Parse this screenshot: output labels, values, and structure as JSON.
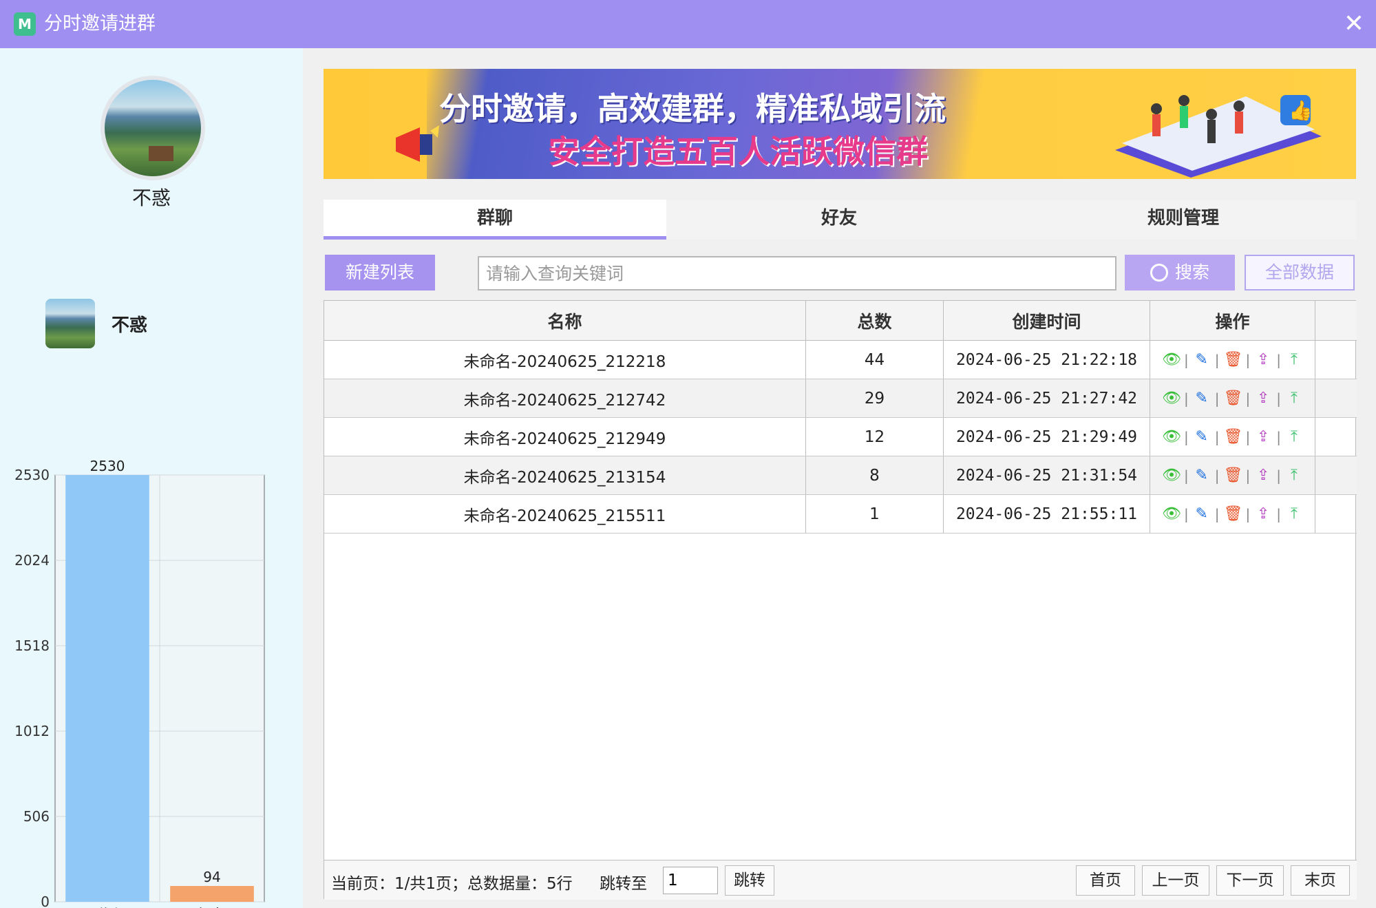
{
  "window": {
    "title": "分时邀请进群",
    "logo_text": "M",
    "close_symbol": "✕"
  },
  "sidebar": {
    "user_name_big": "不惑",
    "user_name_small": "不惑"
  },
  "chart_data": {
    "type": "bar",
    "categories": [
      "群聊",
      "好友"
    ],
    "values": [
      2530,
      94
    ],
    "yticks": [
      0,
      506,
      1012,
      1518,
      2024,
      2530
    ],
    "ylim": [
      0,
      2530
    ],
    "colors": [
      "#90c8f8",
      "#f4a46a"
    ],
    "grid": true,
    "legend": "none"
  },
  "banner": {
    "line1": "分时邀请，高效建群，精准私域引流",
    "line2": "安全打造五百人活跃微信群"
  },
  "tabs": [
    {
      "label": "群聊",
      "active": true
    },
    {
      "label": "好友",
      "active": false
    },
    {
      "label": "规则管理",
      "active": false
    }
  ],
  "toolbar": {
    "new_list_label": "新建列表",
    "search_placeholder": "请输入查询关键词",
    "search_label": "搜索",
    "all_data_label": "全部数据"
  },
  "table": {
    "headers": {
      "name": "名称",
      "total": "总数",
      "time": "创建时间",
      "ops": "操作"
    },
    "rows": [
      {
        "name": "未命名-20240625_212218",
        "total": "44",
        "time": "2024-06-25 21:22:18"
      },
      {
        "name": "未命名-20240625_212742",
        "total": "29",
        "time": "2024-06-25 21:27:42"
      },
      {
        "name": "未命名-20240625_212949",
        "total": "12",
        "time": "2024-06-25 21:29:49"
      },
      {
        "name": "未命名-20240625_213154",
        "total": "8",
        "time": "2024-06-25 21:31:54"
      },
      {
        "name": "未命名-20240625_215511",
        "total": "1",
        "time": "2024-06-25 21:55:11"
      }
    ],
    "op_icons": [
      "eye-icon",
      "edit-icon",
      "delete-icon",
      "export-icon",
      "top-icon"
    ]
  },
  "pager": {
    "info": "当前页：1/共1页；总数据量：5行",
    "jump_label": "跳转至",
    "jump_value": "1",
    "jump_button": "跳转",
    "first": "首页",
    "prev": "上一页",
    "next": "下一页",
    "last": "末页"
  }
}
